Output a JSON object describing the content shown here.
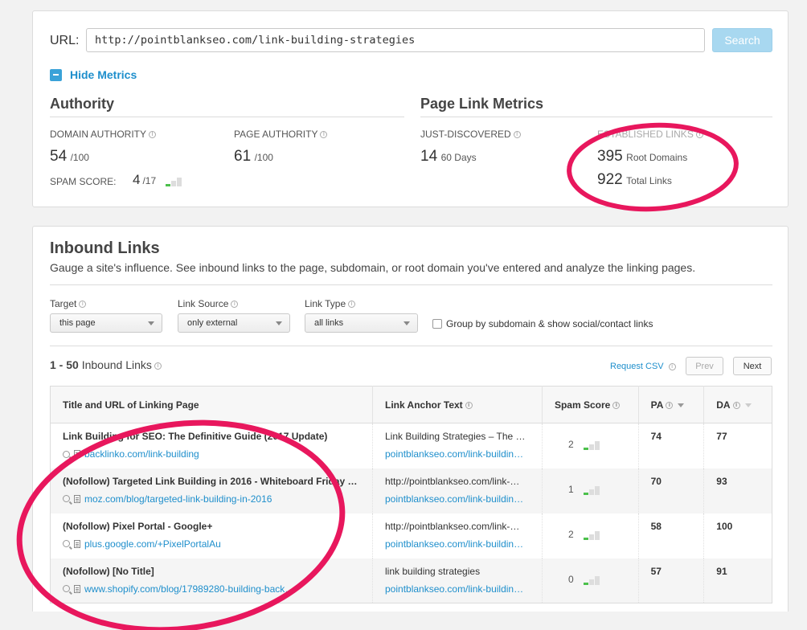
{
  "url_bar": {
    "label": "URL:",
    "value": "http://pointblankseo.com/link-building-strategies",
    "search_label": "Search"
  },
  "metrics_toggle": "Hide Metrics",
  "authority": {
    "title": "Authority",
    "domain_authority": {
      "label": "DOMAIN AUTHORITY",
      "value": "54",
      "max": "/100"
    },
    "page_authority": {
      "label": "PAGE AUTHORITY",
      "value": "61",
      "max": "/100"
    },
    "spam_score": {
      "label": "SPAM SCORE:",
      "value": "4",
      "max": "/17",
      "bars_filled": 1,
      "bars_total": 3
    }
  },
  "page_link_metrics": {
    "title": "Page Link Metrics",
    "just_discovered": {
      "label": "JUST-DISCOVERED",
      "value": "14",
      "unit": "60 Days"
    },
    "established_links": {
      "label": "ESTABLISHED LINKS",
      "root_domains": "395",
      "root_domains_label": "Root Domains",
      "total_links": "922",
      "total_links_label": "Total Links"
    }
  },
  "inbound": {
    "title": "Inbound Links",
    "description": "Gauge a site's influence. See inbound links to the page, subdomain, or root domain you've entered and analyze the linking pages.",
    "filters": {
      "target": {
        "label": "Target",
        "value": "this page"
      },
      "link_source": {
        "label": "Link Source",
        "value": "only external"
      },
      "link_type": {
        "label": "Link Type",
        "value": "all links"
      },
      "group_checkbox": "Group by subdomain & show social/contact links"
    },
    "count_range": "1 - 50",
    "count_label": "Inbound Links",
    "request_csv": "Request CSV",
    "prev": "Prev",
    "next": "Next",
    "columns": {
      "title_url": "Title and URL of Linking Page",
      "anchor": "Link Anchor Text",
      "spam": "Spam Score",
      "pa": "PA",
      "da": "DA"
    },
    "rows": [
      {
        "title": "Link Building for SEO: The Definitive Guide (2017 Update)",
        "url": "backlinko.com/link-building",
        "anchor": "Link Building Strategies – The …",
        "anchor_url": "pointblankseo.com/link-buildin…",
        "spam": "2",
        "spam_bars": 1,
        "pa": "74",
        "da": "77"
      },
      {
        "title": "(Nofollow) Targeted Link Building in 2016 - Whiteboard Friday -…",
        "url": "moz.com/blog/targeted-link-building-in-2016",
        "anchor": "http://pointblankseo.com/link-…",
        "anchor_url": "pointblankseo.com/link-buildin…",
        "spam": "1",
        "spam_bars": 1,
        "pa": "70",
        "da": "93"
      },
      {
        "title": "(Nofollow) Pixel Portal - Google+",
        "url": "plus.google.com/+PixelPortalAu",
        "anchor": "http://pointblankseo.com/link-…",
        "anchor_url": "pointblankseo.com/link-buildin…",
        "spam": "2",
        "spam_bars": 1,
        "pa": "58",
        "da": "100"
      },
      {
        "title": "(Nofollow) [No Title]",
        "url": "www.shopify.com/blog/17989280-building-back…",
        "anchor": "link building strategies",
        "anchor_url": "pointblankseo.com/link-buildin…",
        "spam": "0",
        "spam_bars": 1,
        "pa": "57",
        "da": "91"
      }
    ]
  },
  "colors": {
    "accent": "#1f8fcc",
    "annotation": "#e8175d",
    "bar_green": "#4cc04c",
    "bar_gray": "#dddddd"
  }
}
